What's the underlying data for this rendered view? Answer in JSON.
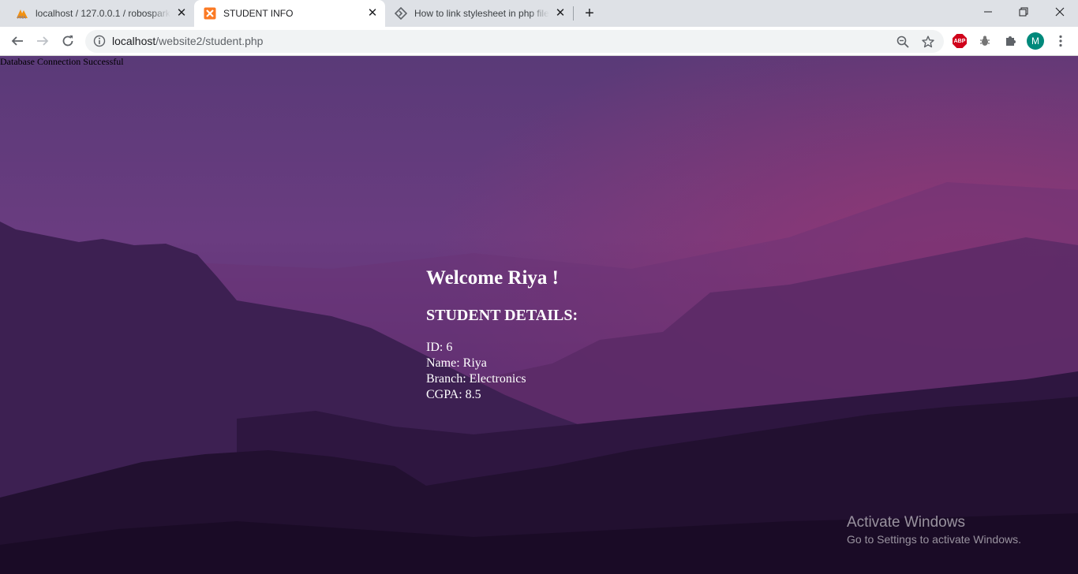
{
  "tabs": [
    {
      "title": "localhost / 127.0.0.1 / robospark",
      "favicon": "phpmyadmin-icon",
      "active": false
    },
    {
      "title": "STUDENT INFO",
      "favicon": "xampp-icon",
      "active": true
    },
    {
      "title": "How to link stylesheet in php file",
      "favicon": "diamond-arrow-icon",
      "active": false
    }
  ],
  "toolbar": {
    "url_host": "localhost",
    "url_path": "/website2/student.php",
    "avatar_letter": "M"
  },
  "page": {
    "db_status": "Database Connection Successful",
    "welcome": "Welcome Riya !",
    "section_title": "STUDENT DETAILS:",
    "details": [
      "ID: 6",
      "Name: Riya",
      "Branch: Electronics",
      "CGPA: 8.5"
    ]
  },
  "watermark": {
    "title": "Activate Windows",
    "subtitle": "Go to Settings to activate Windows."
  },
  "colors": {
    "accent_avatar": "#00897b",
    "abp_red": "#d0021b",
    "page_text": "#ffffff"
  }
}
